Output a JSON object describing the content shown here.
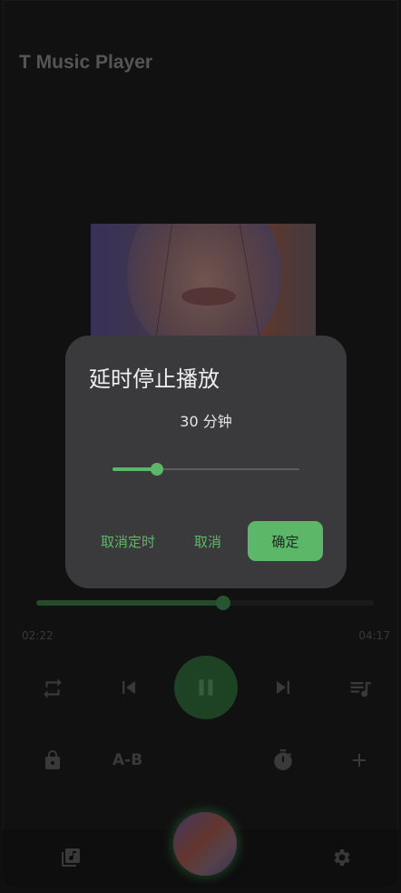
{
  "app": {
    "title": "T Music Player"
  },
  "player": {
    "current_time": "02:22",
    "total_time": "04:17",
    "progress": 0.553,
    "ab_label": "A-B"
  },
  "dialog": {
    "title": "延时停止播放",
    "minutes_label": "30 分钟",
    "slider_value": 0.24,
    "cancel_timer_label": "取消定时",
    "cancel_label": "取消",
    "confirm_label": "确定"
  },
  "colors": {
    "accent": "#5cb868",
    "accent_dim": "#2f6b3a",
    "dialog_bg": "#3a3a3c"
  },
  "icons": {
    "repeat": "repeat-icon",
    "previous": "skip-previous-icon",
    "pause": "pause-icon",
    "next": "skip-next-icon",
    "queue": "queue-music-icon",
    "lock": "lock-icon",
    "timer": "timer-icon",
    "add": "add-icon",
    "library": "library-music-icon",
    "settings": "settings-icon"
  }
}
